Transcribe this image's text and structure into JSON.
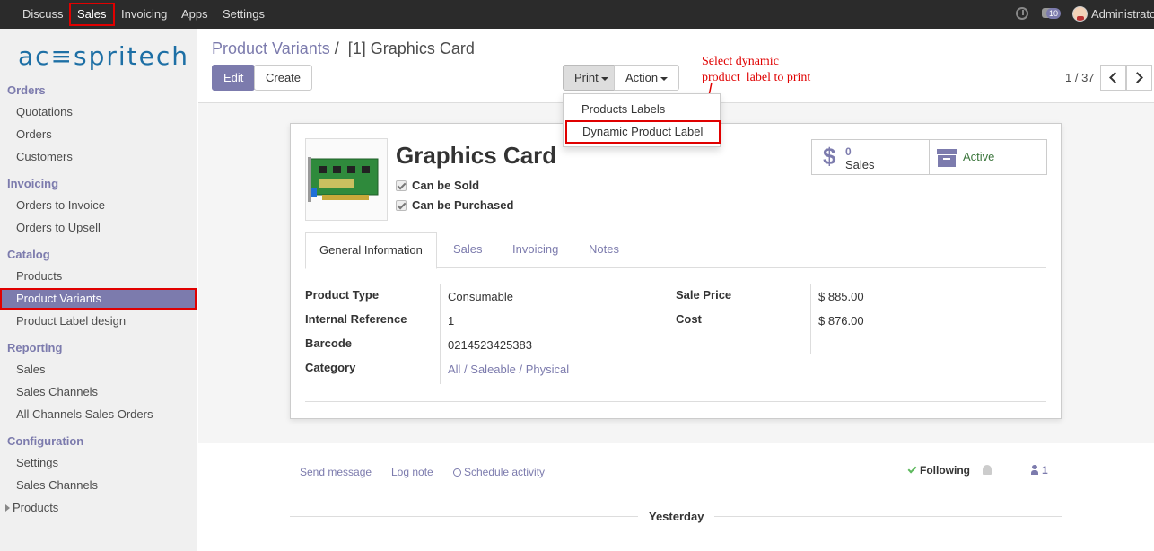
{
  "topnav": {
    "items": [
      "Discuss",
      "Sales",
      "Invoicing",
      "Apps",
      "Settings"
    ],
    "chat_badge": "10",
    "user": "Administrator"
  },
  "logo": "ac≡spritech",
  "sidebar": {
    "sections": [
      {
        "title": "Orders",
        "items": [
          "Quotations",
          "Orders",
          "Customers"
        ]
      },
      {
        "title": "Invoicing",
        "items": [
          "Orders to Invoice",
          "Orders to Upsell"
        ]
      },
      {
        "title": "Catalog",
        "items": [
          "Products",
          "Product Variants",
          "Product Label design"
        ]
      },
      {
        "title": "Reporting",
        "items": [
          "Sales",
          "Sales Channels",
          "All Channels Sales Orders"
        ]
      },
      {
        "title": "Configuration",
        "items": [
          "Settings",
          "Sales Channels",
          "Products"
        ]
      }
    ]
  },
  "breadcrumb": {
    "parent": "Product Variants",
    "separator": "/",
    "current": "[1] Graphics Card"
  },
  "toolbar": {
    "edit": "Edit",
    "create": "Create",
    "print": "Print",
    "action": "Action"
  },
  "pager": {
    "text": "1 / 37"
  },
  "annotation": "Select dynamic\nproduct  label to print",
  "print_menu": {
    "items": [
      "Products Labels",
      "Dynamic Product Label"
    ]
  },
  "product": {
    "name": "Graphics Card",
    "can_be_sold": "Can be Sold",
    "can_be_purchased": "Can be Purchased",
    "sales_count": "0",
    "sales_label": "Sales",
    "active_label": "Active"
  },
  "tabs": [
    "General Information",
    "Sales",
    "Invoicing",
    "Notes"
  ],
  "fields_left": [
    {
      "label": "Product Type",
      "value": "Consumable"
    },
    {
      "label": "Internal Reference",
      "value": "1"
    },
    {
      "label": "Barcode",
      "value": "0214523425383"
    },
    {
      "label": "Category",
      "value": "All / Saleable / Physical"
    }
  ],
  "fields_right": [
    {
      "label": "Sale Price",
      "value": "$ 885.00"
    },
    {
      "label": "Cost",
      "value": "$ 876.00"
    }
  ],
  "chatter": {
    "send_message": "Send message",
    "log_note": "Log note",
    "schedule_activity": "Schedule activity",
    "following": "Following",
    "followers": "1",
    "date_separator": "Yesterday"
  },
  "colors": {
    "accent": "#7c7bad",
    "highlight": "#e00000",
    "topbar": "#2b2b2b"
  }
}
